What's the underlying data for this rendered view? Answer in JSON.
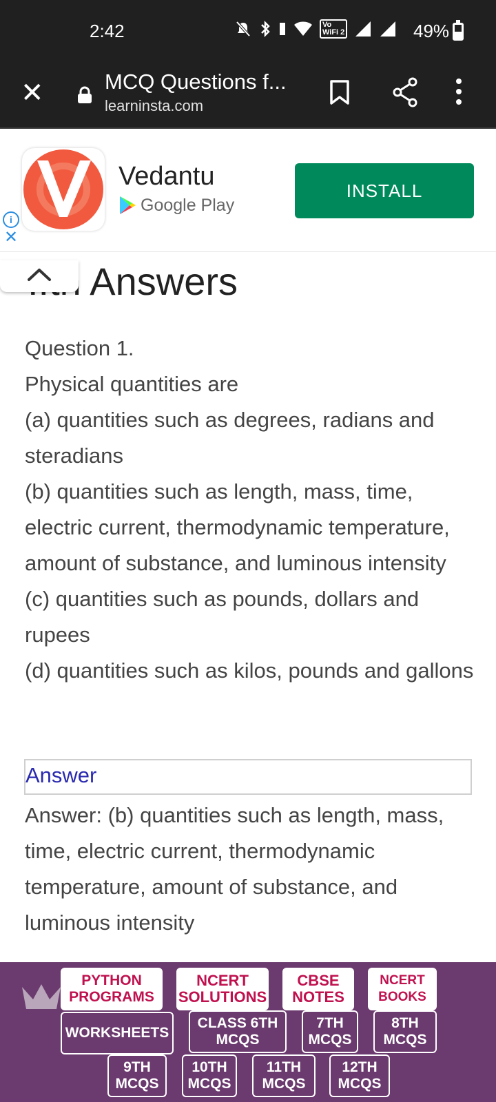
{
  "status_bar": {
    "time": "2:42",
    "wifi_label_top": "Vo",
    "wifi_label_bottom": "WiFi 2",
    "battery_percent": "49%",
    "battery_level": 0.49
  },
  "toolbar": {
    "title": "MCQ Questions f...",
    "url": "learninsta.com"
  },
  "ad": {
    "app_name": "Vedantu",
    "store_name": "Google Play",
    "install_label": "INSTALL",
    "install_color": "#008a5c"
  },
  "page": {
    "heading": "..th Answers",
    "question_label": "Question 1.",
    "question_text": "Physical quantities are",
    "options": [
      "(a) quantities such as degrees, radians and steradians",
      "(b) quantities such as length, mass, time, electric current, thermodynamic temperature, amount of substance, and luminous intensity",
      "(c) quantities such as pounds, dollars and rupees",
      "(d) quantities such as kilos, pounds and gallons"
    ],
    "answer_toggle": "Answer",
    "answer_text": "Answer: (b) quantities such as length, mass, time, electric current, thermodynamic temperature, amount of substance, and luminous intensity"
  },
  "footer_nav": {
    "bg_color": "#6b3a6e",
    "python": [
      "PYTHON",
      "PROGRAMS"
    ],
    "ncert_solutions": [
      "NCERT",
      "SOLUTIONS"
    ],
    "cbse_notes": [
      "CBSE",
      "NOTES"
    ],
    "ncert_books": [
      "NCERT",
      "BOOKS"
    ],
    "worksheets": "WORKSHEETS",
    "class6": [
      "CLASS 6TH",
      "MCQS"
    ],
    "class7": [
      "7TH",
      "MCQS"
    ],
    "class8": [
      "8TH",
      "MCQS"
    ],
    "class9": [
      "9TH",
      "MCQS"
    ],
    "class10": [
      "10TH",
      "MCQS"
    ],
    "class11": [
      "11TH",
      "MCQS"
    ],
    "class12": [
      "12TH",
      "MCQS"
    ]
  }
}
